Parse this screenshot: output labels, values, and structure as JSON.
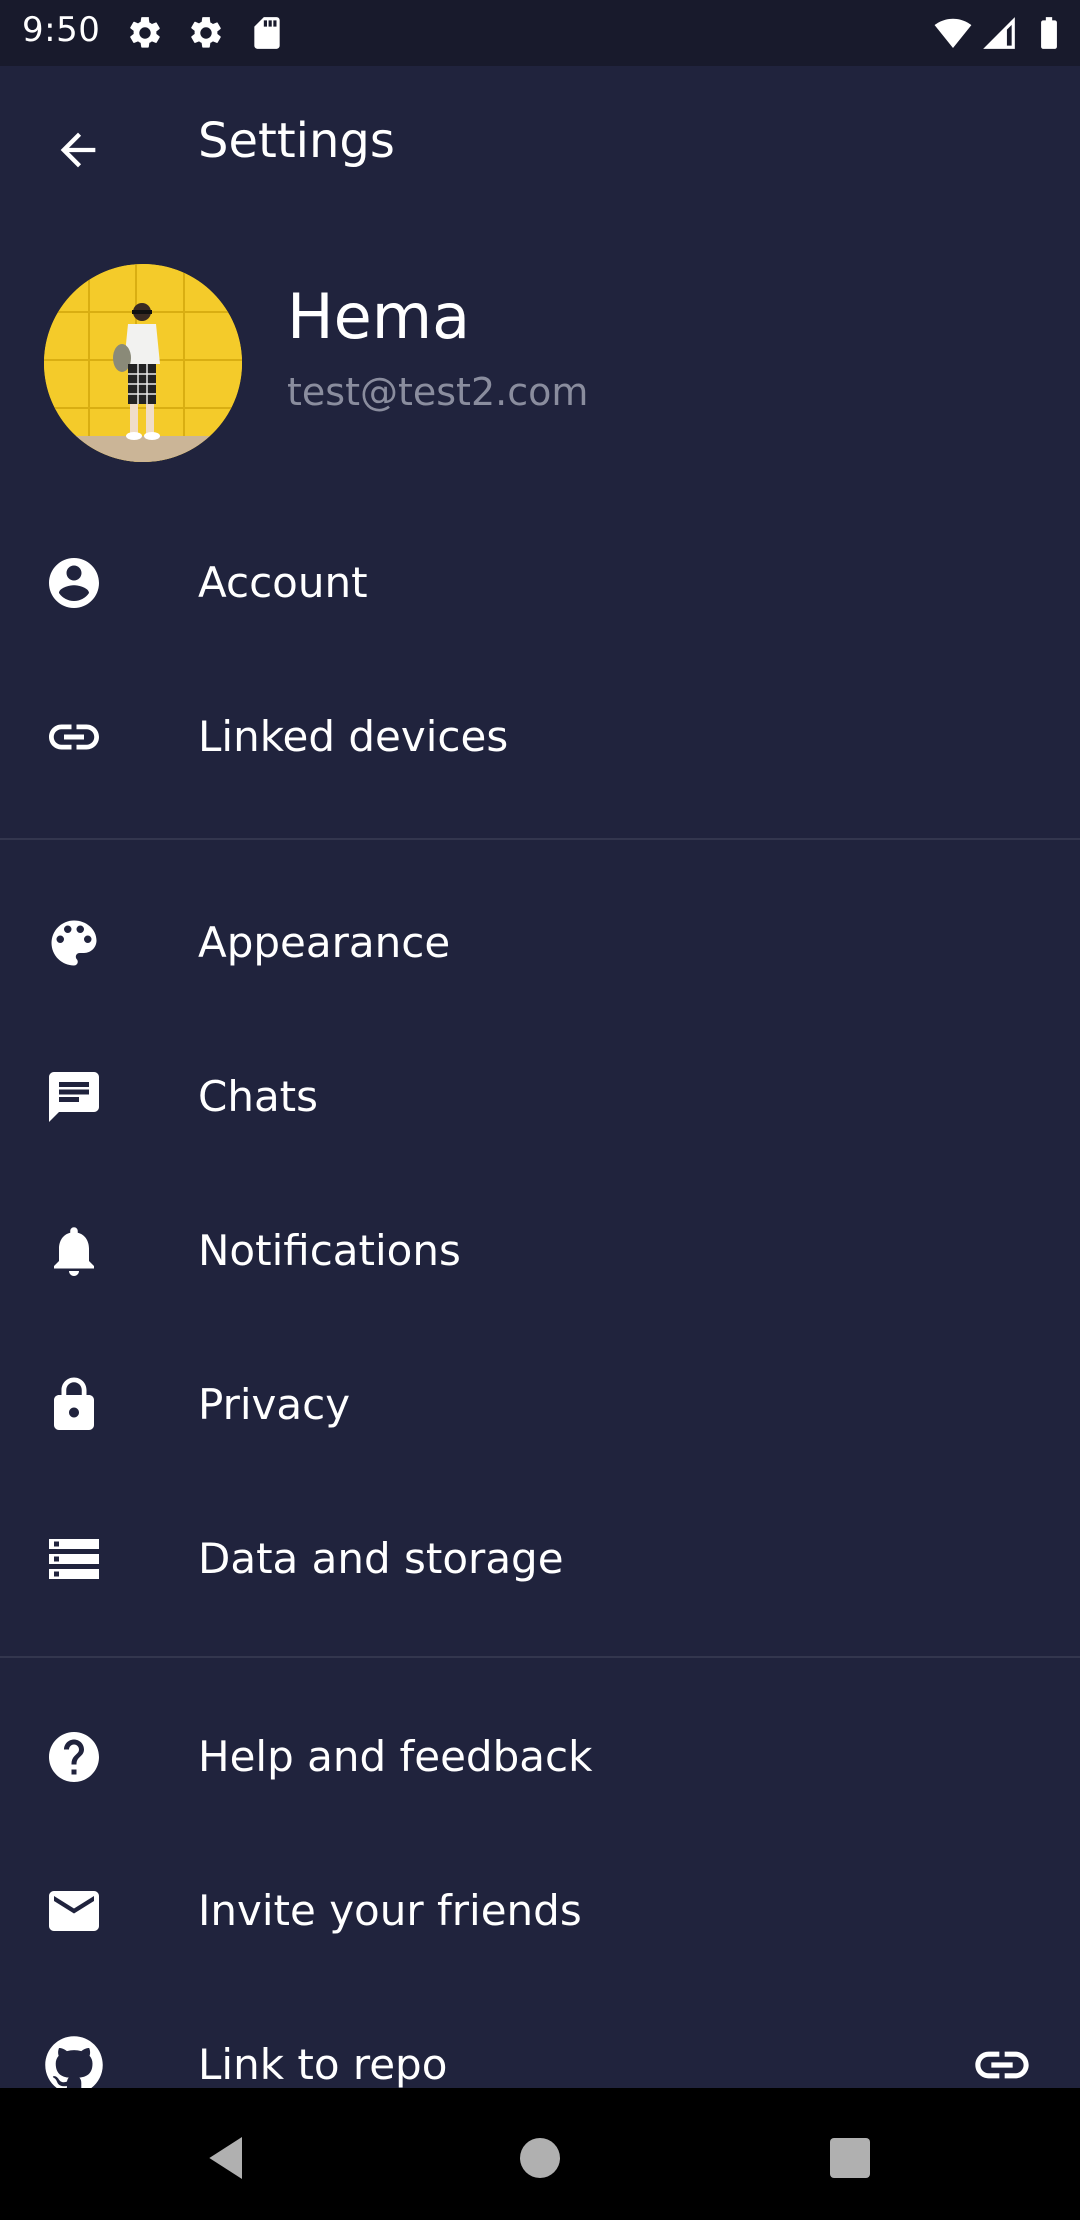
{
  "status_bar": {
    "time": "9:50",
    "left_icons": [
      "gear-icon",
      "gear-icon",
      "sd-card-icon"
    ],
    "right_icons": [
      "wifi-icon",
      "signal-icon",
      "battery-icon"
    ]
  },
  "app_bar": {
    "title": "Settings",
    "back_icon": "arrow-back-icon"
  },
  "profile": {
    "name": "Hema",
    "email": "test@test2.com"
  },
  "groups": [
    [
      {
        "label": "Account",
        "icon": "account-circle-icon"
      },
      {
        "label": "Linked devices",
        "icon": "link-icon"
      }
    ],
    [
      {
        "label": "Appearance",
        "icon": "palette-icon"
      },
      {
        "label": "Chats",
        "icon": "chat-icon"
      },
      {
        "label": "Notifications",
        "icon": "bell-icon"
      },
      {
        "label": "Privacy",
        "icon": "lock-icon"
      },
      {
        "label": "Data and storage",
        "icon": "storage-icon"
      }
    ],
    [
      {
        "label": "Help and feedback",
        "icon": "help-icon"
      },
      {
        "label": "Invite your friends",
        "icon": "mail-icon"
      },
      {
        "label": "Link to repo",
        "icon": "github-icon",
        "trailing_icon": "link-icon"
      }
    ]
  ],
  "colors": {
    "background": "#20233d",
    "status_bar": "#181a2c",
    "divider": "#33364e",
    "secondary_text": "#8a8d9e",
    "nav_bar": "#000000"
  }
}
